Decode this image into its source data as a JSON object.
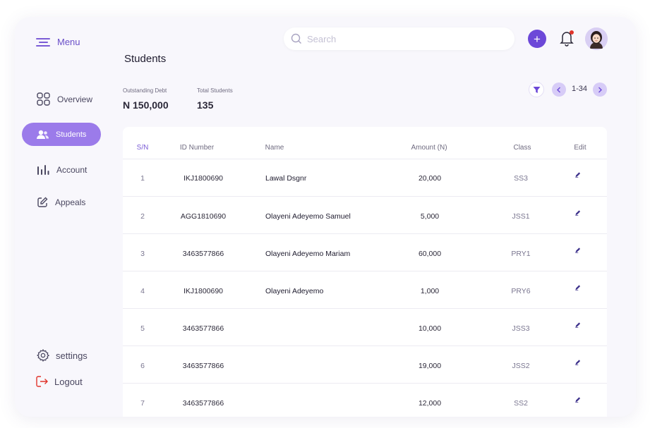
{
  "sidebar": {
    "menu_label": "Menu",
    "items": [
      {
        "label": "Overview"
      },
      {
        "label": "Students"
      },
      {
        "label": "Account"
      },
      {
        "label": "Appeals"
      }
    ],
    "settings_label": "settings",
    "logout_label": "Logout"
  },
  "header": {
    "search_placeholder": "Search"
  },
  "page": {
    "title": "Students"
  },
  "stats": {
    "outstanding_debt_label": "Outstanding Debt",
    "outstanding_debt_value": "N 150,000",
    "total_students_label": "Total Students",
    "total_students_value": "135"
  },
  "pagination": {
    "range": "1-34"
  },
  "table": {
    "headers": {
      "sn": "S/N",
      "id": "ID Number",
      "name": "Name",
      "amount": "Amount (N)",
      "class": "Class",
      "edit": "Edit"
    },
    "rows": [
      {
        "sn": "1",
        "id": "IKJ1800690",
        "name": "Lawal Dsgnr",
        "amount": "20,000",
        "class": "SS3"
      },
      {
        "sn": "2",
        "id": "AGG1810690",
        "name": "Olayeni Adeyemo Samuel",
        "amount": "5,000",
        "class": "JSS1"
      },
      {
        "sn": "3",
        "id": "3463577866",
        "name": "Olayeni Adeyemo Mariam",
        "amount": "60,000",
        "class": "PRY1"
      },
      {
        "sn": "4",
        "id": "IKJ1800690",
        "name": "Olayeni Adeyemo",
        "amount": "1,000",
        "class": "PRY6"
      },
      {
        "sn": "5",
        "id": "3463577866",
        "name": "",
        "amount": "10,000",
        "class": "JSS3"
      },
      {
        "sn": "6",
        "id": "3463577866",
        "name": "",
        "amount": "19,000",
        "class": "JSS2"
      },
      {
        "sn": "7",
        "id": "3463577866",
        "name": "",
        "amount": "12,000",
        "class": "SS2"
      }
    ]
  },
  "colors": {
    "accent": "#6c48d8",
    "sidebar_active": "#9b7bea",
    "notification_dot": "#e0342b"
  },
  "icons": {
    "menu": "hamburger-icon",
    "overview": "grid-icon",
    "students": "users-icon",
    "account": "bar-chart-icon",
    "appeals": "edit-square-icon",
    "settings": "gear-icon",
    "logout": "logout-icon",
    "search": "search-icon",
    "add": "plus-icon",
    "notifications": "bell-icon",
    "filter": "filter-icon",
    "prev": "chevron-left-icon",
    "next": "chevron-right-icon",
    "edit": "pencil-icon"
  }
}
